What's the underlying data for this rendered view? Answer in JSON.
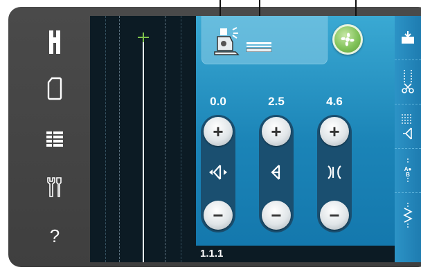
{
  "left_menu": {
    "items": [
      {
        "name": "presser-foot-up-icon"
      },
      {
        "name": "bobbin-icon"
      },
      {
        "name": "menu-list-icon"
      },
      {
        "name": "settings-tools-icon"
      },
      {
        "name": "help-icon",
        "label": "?"
      }
    ]
  },
  "info_box": {
    "icons": [
      "presser-foot-sensor-icon",
      "stitch-length-indicator-icon"
    ]
  },
  "fan_button": {
    "icon": "fan-icon"
  },
  "adjusters": [
    {
      "id": "stitch-position",
      "value": "0.0",
      "icon": "stitch-position-icon",
      "plus": "+",
      "minus": "−"
    },
    {
      "id": "stitch-width",
      "value": "2.5",
      "icon": "stitch-width-icon",
      "plus": "+",
      "minus": "−"
    },
    {
      "id": "stitch-length",
      "value": "4.6",
      "icon": "stitch-length-icon",
      "plus": "+",
      "minus": "−"
    }
  ],
  "status_bar": {
    "stitch_number": "1.1.1"
  },
  "right_toolbar": {
    "items": [
      "load-icon",
      "cut-tie-icon",
      "sequence-icon",
      "text-abc-icon",
      "mirror-stitch-icon"
    ]
  },
  "colors": {
    "panel_blue": "#1b84b7",
    "fan_green": "#82c35a",
    "bezel": "#444444",
    "screen_dark": "#0c1b24"
  }
}
